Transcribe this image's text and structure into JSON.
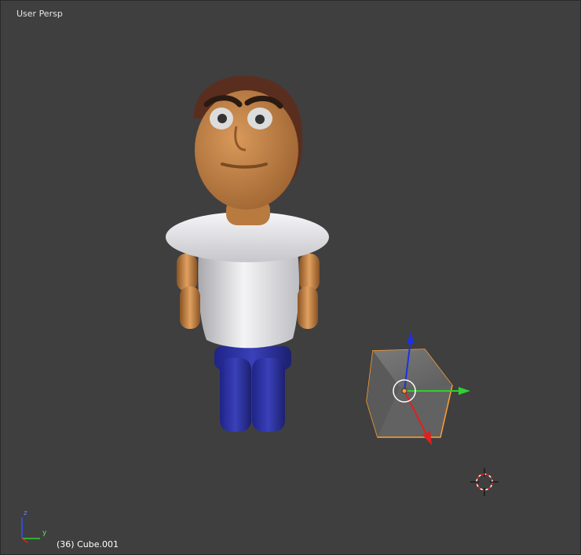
{
  "viewport": {
    "view_label": "User Persp",
    "status": "(36) Cube.001",
    "background_color": "#3f3f3f"
  },
  "axis_widget": {
    "z_label": "z",
    "y_label": "y"
  },
  "colors": {
    "selection_outline": "#ff9f30",
    "x_axis": "#e02020",
    "y_axis": "#30d030",
    "z_axis": "#2030e0",
    "shirt": "#e8e8ea",
    "pants": "#2a2f9e",
    "skin": "#c98a4c",
    "hair": "#5a2e1e"
  },
  "icons": [
    "3d-cursor-icon",
    "transform-manipulator-icon",
    "axis-widget-icon"
  ]
}
